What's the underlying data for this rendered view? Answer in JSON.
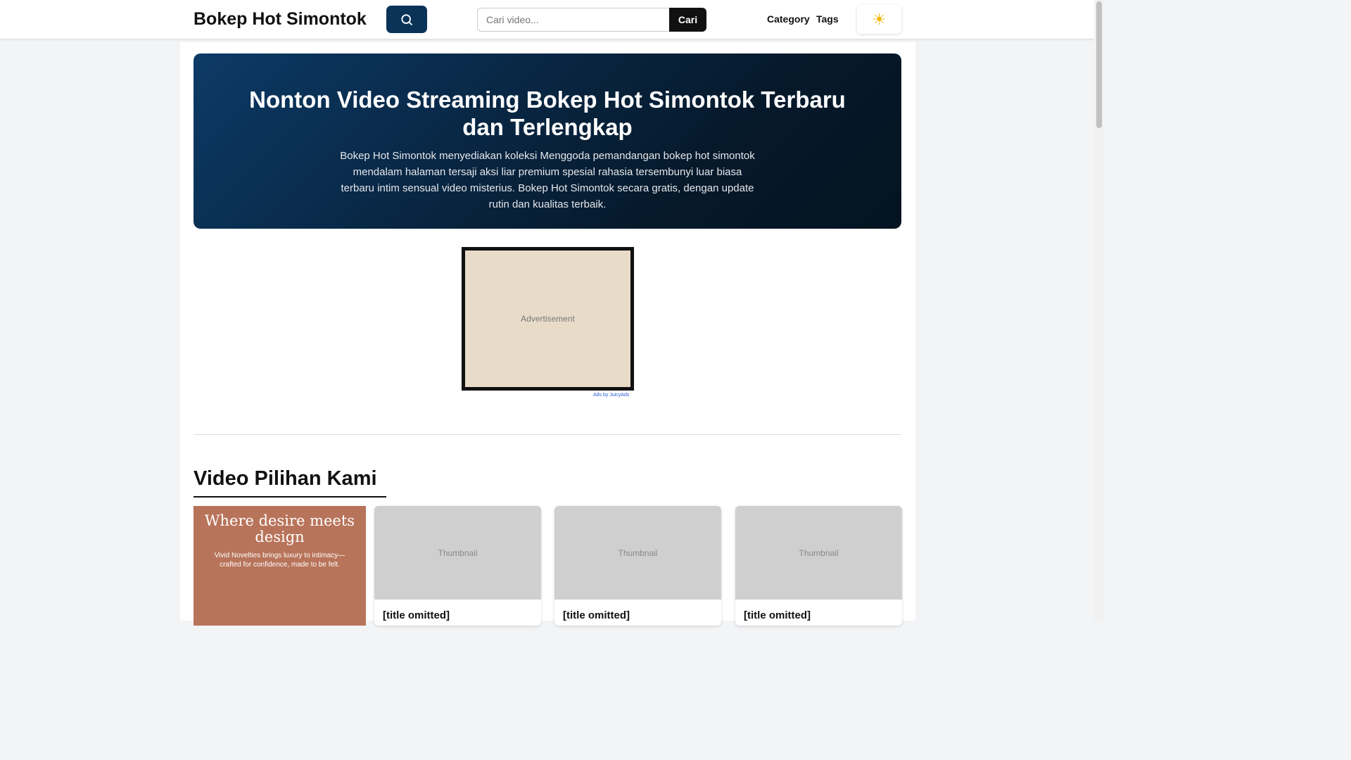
{
  "header": {
    "brand": "Bokep Hot Simontok",
    "search_placeholder": "Cari video...",
    "search_button": "Cari",
    "nav": [
      "Category",
      "Tags"
    ],
    "theme_icon": "☀"
  },
  "hero": {
    "title": "Nonton Video Streaming Bokep Hot Simontok Terbaru dan Terlengkap",
    "description": "Bokep Hot Simontok menyediakan koleksi Menggoda pemandangan bokep hot simontok mendalam halaman tersaji aksi liar premium spesial rahasia tersembunyi luar biasa terbaru intim sensual video misterius. Bokep Hot Simontok secara gratis, dengan update rutin dan kualitas terbaik."
  },
  "ad": {
    "placeholder": "Advertisement",
    "ads_by": "Ads by JuicyAds"
  },
  "section": {
    "title": "Video Pilihan Kami"
  },
  "promo": {
    "headline": "Where desire meets design",
    "sub": "Vivid Novelties brings luxury to intimacy—crafted for confidence, made to be felt."
  },
  "cards": [
    {
      "title": "[title omitted]",
      "thumb": "Thumbnail"
    },
    {
      "title": "[title omitted]",
      "thumb": "Thumbnail"
    },
    {
      "title": "[title omitted]",
      "thumb": "Thumbnail"
    }
  ]
}
